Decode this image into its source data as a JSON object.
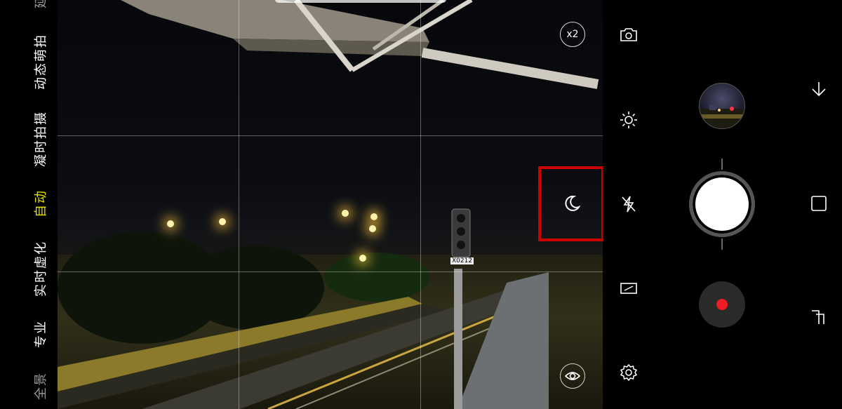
{
  "modes": [
    {
      "label": "延",
      "state": "dim"
    },
    {
      "label": "动态萌拍",
      "state": "normal"
    },
    {
      "label": "凝时拍摄",
      "state": "normal"
    },
    {
      "label": "自动",
      "state": "active"
    },
    {
      "label": "实时虚化",
      "state": "normal"
    },
    {
      "label": "专业",
      "state": "normal"
    },
    {
      "label": "全景",
      "state": "dim"
    }
  ],
  "viewfinder": {
    "zoom_label": "x2",
    "signal_plate": "X0212",
    "night_mode_icon": "moon-icon",
    "eye_icon": "eye-icon",
    "highlight_color": "#cc0000"
  },
  "toolbar": {
    "items": [
      "switch-camera-icon",
      "brightness-icon",
      "flash-off-icon",
      "aspect-ratio-icon",
      "settings-icon"
    ]
  },
  "controls": {
    "thumbnail": "gallery-thumbnail",
    "shutter": "shutter-button",
    "record": "record-button",
    "record_color": "#ee1c24"
  },
  "nav": {
    "items": [
      "back-arrow-icon",
      "home-square-icon",
      "recent-apps-icon"
    ]
  }
}
